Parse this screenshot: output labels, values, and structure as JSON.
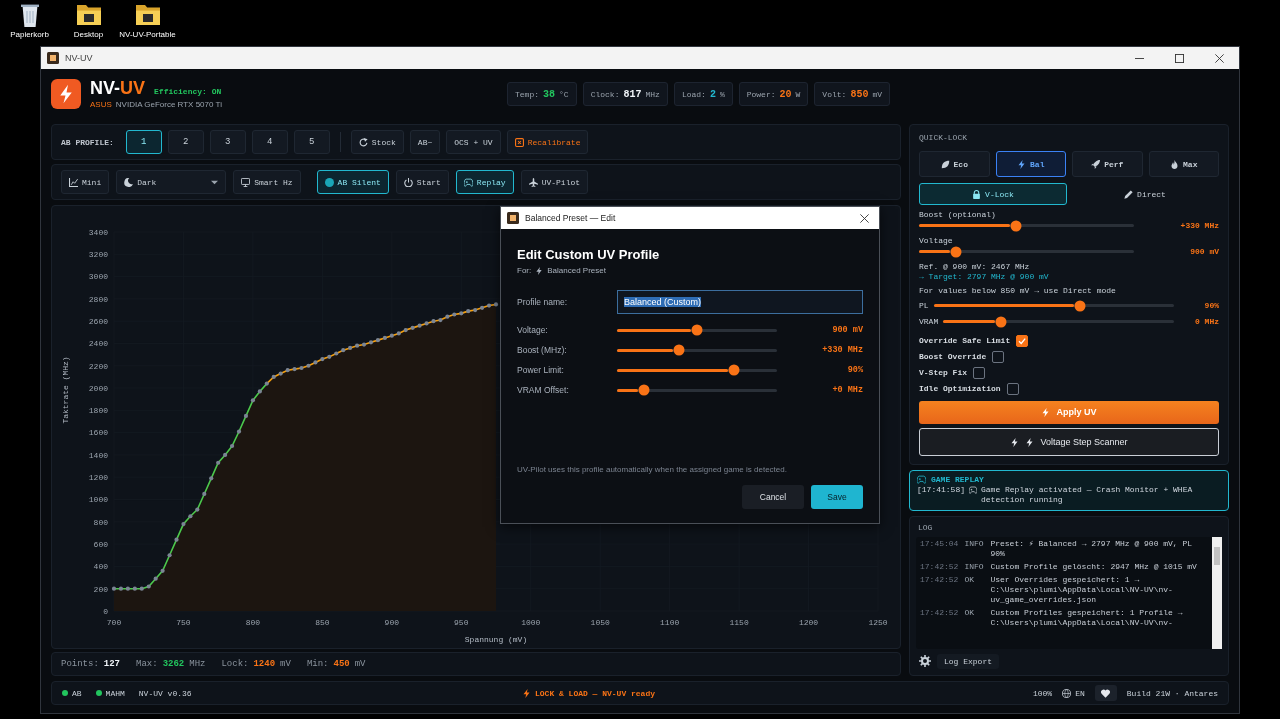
{
  "desktop_icons": [
    {
      "kind": "bin",
      "label": "Papierkorb"
    },
    {
      "kind": "folder",
      "label": "Desktop"
    },
    {
      "kind": "folder",
      "label": "NV-UV-Portable"
    }
  ],
  "window": {
    "title": "NV-UV"
  },
  "header": {
    "name": "NV-",
    "name_accent": "UV",
    "efficiency": "Efficiency: ON",
    "vendor": "ASUS",
    "gpu": "NVIDIA GeForce RTX 5070 Ti",
    "stats": [
      {
        "label": "Temp:",
        "value": "38",
        "unit": "°C",
        "color": "#22c55e"
      },
      {
        "label": "Clock:",
        "value": "817",
        "unit": "MHz",
        "color": "#f1f5f9"
      },
      {
        "label": "Load:",
        "value": "2",
        "unit": "%",
        "color": "#22b8cf"
      },
      {
        "label": "Power:",
        "value": "20",
        "unit": "W",
        "color": "#f97316"
      },
      {
        "label": "Volt:",
        "value": "850",
        "unit": "mV",
        "color": "#f97316"
      }
    ]
  },
  "profile_bar": {
    "label": "AB PROFILE:",
    "slots": [
      {
        "label": "1",
        "selected": true
      },
      {
        "label": "2",
        "selected": false
      },
      {
        "label": "3",
        "selected": false
      },
      {
        "label": "4",
        "selected": false
      },
      {
        "label": "5",
        "selected": false
      }
    ],
    "actions": [
      {
        "kind": "reset",
        "label": "Stock"
      },
      {
        "kind": "plain",
        "label": "AB~"
      },
      {
        "kind": "plain",
        "label": "OCS + UV"
      },
      {
        "kind": "alert",
        "label": "Recalibrate"
      }
    ]
  },
  "toolbar": [
    {
      "kind": "mini",
      "label": "Mini",
      "on": false
    },
    {
      "kind": "select",
      "value": "Dark"
    },
    {
      "kind": "monitor",
      "label": "Smart Hz",
      "on": false
    },
    {
      "kind": "silent",
      "label": "AB Silent",
      "on": true
    },
    {
      "kind": "power",
      "label": "Start",
      "on": false
    },
    {
      "kind": "gamepad",
      "label": "Replay",
      "on": true
    },
    {
      "kind": "plane",
      "label": "UV-Pilot",
      "on": false
    }
  ],
  "chart": {
    "chart_data": {
      "type": "line",
      "xlabel": "Spannung (mV)",
      "ylabel": "Taktrate (MHz)",
      "x": [
        700,
        705,
        710,
        715,
        720,
        725,
        730,
        735,
        740,
        745,
        750,
        755,
        760,
        765,
        770,
        775,
        780,
        785,
        790,
        795,
        800,
        805,
        810,
        815,
        820,
        825,
        830,
        835,
        840,
        845,
        850,
        855,
        860,
        865,
        870,
        875,
        880,
        885,
        890,
        895,
        900,
        905,
        910,
        915,
        920,
        925,
        930,
        935,
        940,
        945,
        950,
        955,
        960,
        965,
        970,
        975
      ],
      "series": [
        {
          "color": "#4cc94c",
          "values": [
            200,
            200,
            200,
            200,
            200,
            220,
            290,
            360,
            500,
            640,
            780,
            850,
            910,
            1050,
            1190,
            1330,
            1400,
            1480,
            1610,
            1750,
            1890,
            1970,
            2040,
            null,
            null,
            null,
            null,
            null,
            null,
            null,
            null,
            null,
            null,
            null,
            null,
            null,
            null,
            null,
            null,
            null,
            null,
            null,
            null,
            null,
            null,
            null,
            null,
            null,
            null,
            null,
            null,
            null,
            null,
            null,
            null,
            null
          ]
        },
        {
          "color": "#f59e0b",
          "values": [
            null,
            null,
            null,
            null,
            null,
            null,
            null,
            null,
            null,
            null,
            null,
            null,
            null,
            null,
            null,
            null,
            null,
            null,
            null,
            null,
            null,
            null,
            2040,
            2100,
            2130,
            2160,
            2170,
            2180,
            2200,
            2230,
            2260,
            2280,
            2310,
            2340,
            2360,
            2380,
            2390,
            2410,
            2430,
            2450,
            2470,
            2490,
            2520,
            2540,
            2560,
            2580,
            2600,
            2610,
            2640,
            2660,
            2670,
            2690,
            2700,
            2720,
            2740,
            2750
          ]
        }
      ],
      "xlim": [
        700,
        1250
      ],
      "ylim": [
        0,
        3400
      ],
      "xticks": [
        700,
        750,
        800,
        850,
        900,
        950,
        1000,
        1050,
        1100,
        1150,
        1200,
        1250
      ],
      "yticks": [
        0,
        200,
        400,
        600,
        800,
        1000,
        1200,
        1400,
        1600,
        1800,
        2000,
        2200,
        2400,
        2600,
        2800,
        3000,
        3200,
        3400
      ]
    }
  },
  "summary": [
    {
      "label": "Points:",
      "value": "127",
      "color": "#f1f5f9"
    },
    {
      "label": "Max:",
      "value": "3262",
      "unit": "MHz",
      "color": "#22c55e"
    },
    {
      "label": "Lock:",
      "value": "1240",
      "unit": "mV",
      "color": "#f97316"
    },
    {
      "label": "Min:",
      "value": "450",
      "unit": "mV",
      "color": "#f97316"
    }
  ],
  "quick_lock": {
    "title": "QUICK-LOCK",
    "presets": [
      {
        "kind": "eco",
        "label": "Eco",
        "selected": false
      },
      {
        "kind": "bal",
        "label": "Bal",
        "selected": true
      },
      {
        "kind": "perf",
        "label": "Perf",
        "selected": false
      },
      {
        "kind": "max",
        "label": "Max",
        "selected": false
      }
    ],
    "modes": [
      {
        "kind": "lock",
        "label": "V-Lock",
        "selected": true
      },
      {
        "kind": "direct",
        "label": "Direct",
        "selected": false
      }
    ],
    "boost": {
      "label": "Boost (optional)",
      "level": 0.45,
      "reading": "+330 MHz"
    },
    "voltage": {
      "label": "Voltage",
      "level": 0.17,
      "reading": "900 mV"
    },
    "reference": "Ref. @ 900 mV: 2467 MHz",
    "target": "→ Target: 2797 MHz @ 900 mV",
    "hint": "For values below 850 mV → use Direct mode",
    "limits": [
      {
        "label": "PL",
        "level": 0.61,
        "reading": "90%"
      },
      {
        "label": "VRAM",
        "level": 0.25,
        "reading": "0 MHz"
      }
    ],
    "options": [
      {
        "label": "Override Safe Limit",
        "checked": true
      },
      {
        "label": "Boost Override",
        "checked": false
      },
      {
        "label": "V-Step Fix",
        "checked": false
      },
      {
        "label": "Idle Optimization",
        "checked": false
      }
    ],
    "apply_button": "Apply UV",
    "scanner_button": "Voltage Step Scanner"
  },
  "game_replay": {
    "title": "GAME REPLAY",
    "time": "[17:41:58]",
    "message": "Game Replay activated — Crash Monitor + WHEA detection running"
  },
  "log": {
    "title": "LOG",
    "entries": [
      {
        "time": "17:45:04",
        "level": "INFO",
        "message": "Preset: ⚡ Balanced → 2797 MHz @ 900 mV, PL 90%"
      },
      {
        "time": "17:42:52",
        "level": "INFO",
        "message": "Custom Profile gelöscht: 2947 MHz @ 1015 mV"
      },
      {
        "time": "17:42:52",
        "level": "OK",
        "message": "User Overrides gespeichert: 1 → C:\\Users\\plumi\\AppData\\Local\\NV-UV\\nv-uv_game_overrides.json"
      },
      {
        "time": "17:42:52",
        "level": "OK",
        "message": "Custom Profiles gespeichert: 1 Profile → C:\\Users\\plumi\\AppData\\Local\\NV-UV\\nv-"
      }
    ],
    "export_button": "Log Export"
  },
  "status_bar": {
    "indicators": [
      {
        "label": "AB",
        "color": "#22c55e"
      },
      {
        "label": "MAHM",
        "color": "#22c55e"
      }
    ],
    "version": "NV-UV v0.36",
    "message": "LOCK & LOAD — NV-UV ready",
    "zoom": "100%",
    "language": "EN",
    "build": "Build 21W · Antares"
  },
  "dialog": {
    "title": "Balanced Preset — Edit",
    "heading": "Edit Custom UV Profile",
    "for_label": "For:",
    "for_value": "Balanced Preset",
    "name_label": "Profile name:",
    "name_value": "Balanced (Custom)",
    "name_text_selected": true,
    "sliders": [
      {
        "label": "Voltage:",
        "level": 0.5,
        "reading": "900 mV"
      },
      {
        "label": "Boost (MHz):",
        "level": 0.39,
        "reading": "+330 MHz"
      },
      {
        "label": "Power Limit:",
        "level": 0.73,
        "reading": "90%"
      },
      {
        "label": "VRAM Offset:",
        "level": 0.17,
        "reading": "+0 MHz"
      }
    ],
    "note": "UV-Pilot uses this profile automatically when the assigned game is detected.",
    "buttons": [
      {
        "kind": "secondary",
        "label": "Cancel"
      },
      {
        "kind": "primary",
        "label": "Save"
      }
    ]
  }
}
